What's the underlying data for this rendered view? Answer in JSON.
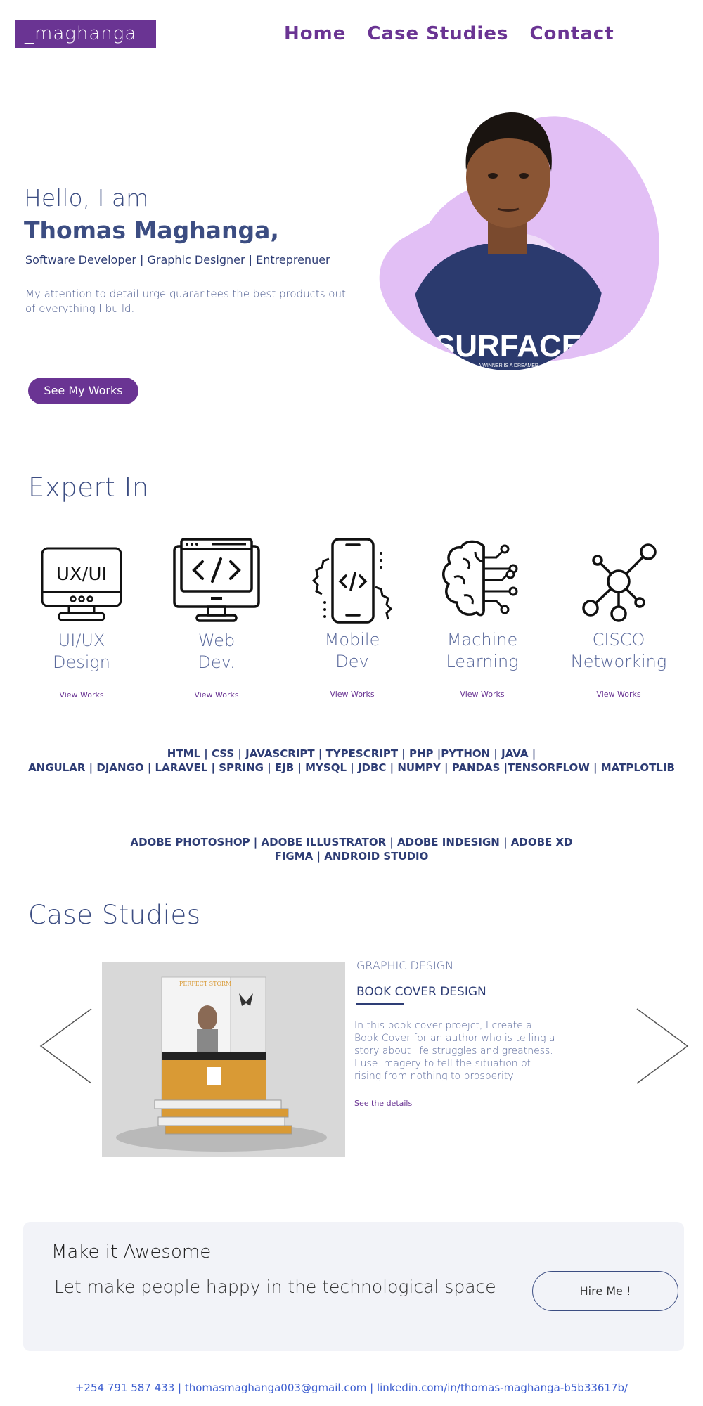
{
  "nav": {
    "logo": "_maghanga",
    "items": [
      "Home",
      "Case Studies",
      "Contact"
    ]
  },
  "hero": {
    "greeting": "Hello, I am",
    "name": "Thomas Maghanga,",
    "roles": "Software Developer | Graphic Designer | Entreprenuer",
    "tagline": "My attention to detail urge guarantees the best products out of everything I build.",
    "cta": "See My Works",
    "shirt_text": "SURFACE",
    "shirt_subtext": "A WINNER IS A DREAMER"
  },
  "expert": {
    "title": "Expert In",
    "skills": [
      {
        "icon": "ux-ui-monitor-icon",
        "icon_text": "UX/UI",
        "label": "UI/UX\nDesign",
        "link": "View Works"
      },
      {
        "icon": "web-dev-monitor-icon",
        "label": "Web\nDev.",
        "link": "View Works"
      },
      {
        "icon": "mobile-dev-icon",
        "label": "Mobile\nDev",
        "link": "View Works"
      },
      {
        "icon": "brain-circuit-icon",
        "label": "Machine\nLearning",
        "link": "View Works"
      },
      {
        "icon": "network-nodes-icon",
        "label": "CISCO\nNetworking",
        "link": "View Works"
      }
    ],
    "tech_line1": "HTML | CSS | JAVASCRIPT | TYPESCRIPT | PHP |PYTHON | JAVA |",
    "tech_line2": "ANGULAR | DJANGO | LARAVEL | SPRING | EJB | MYSQL | JDBC | NUMPY | PANDAS |TENSORFLOW | MATPLOTLIB",
    "tools_line1": "ADOBE PHOTOSHOP | ADOBE ILLUSTRATOR | ADOBE INDESIGN | ADOBE XD",
    "tools_line2": "FIGMA | ANDROID STUDIO"
  },
  "case_studies": {
    "title": "Case Studies",
    "category": "GRAPHIC DESIGN",
    "item_title": "BOOK COVER DESIGN",
    "description": "In this book cover proejct, I create a Book Cover for an author who is telling a story about life struggles and greatness. I use imagery to tell the situation of rising from nothing to prosperity",
    "link": "See the details",
    "book_title": "PERFECT STORM"
  },
  "cta": {
    "heading": "Make it Awesome",
    "text": "Let make people happy in the technological space",
    "button": "Hire Me !"
  },
  "footer": {
    "contact": "+254 791 587 433 | thomasmaghanga003@gmail.com | linkedin.com/in/thomas-maghanga-b5b33617b/"
  },
  "colors": {
    "brand_purple": "#6a3493",
    "text_navy": "#3c4d82",
    "blob_lilac": "#e2bff5",
    "footer_link": "#3e5fd0"
  }
}
